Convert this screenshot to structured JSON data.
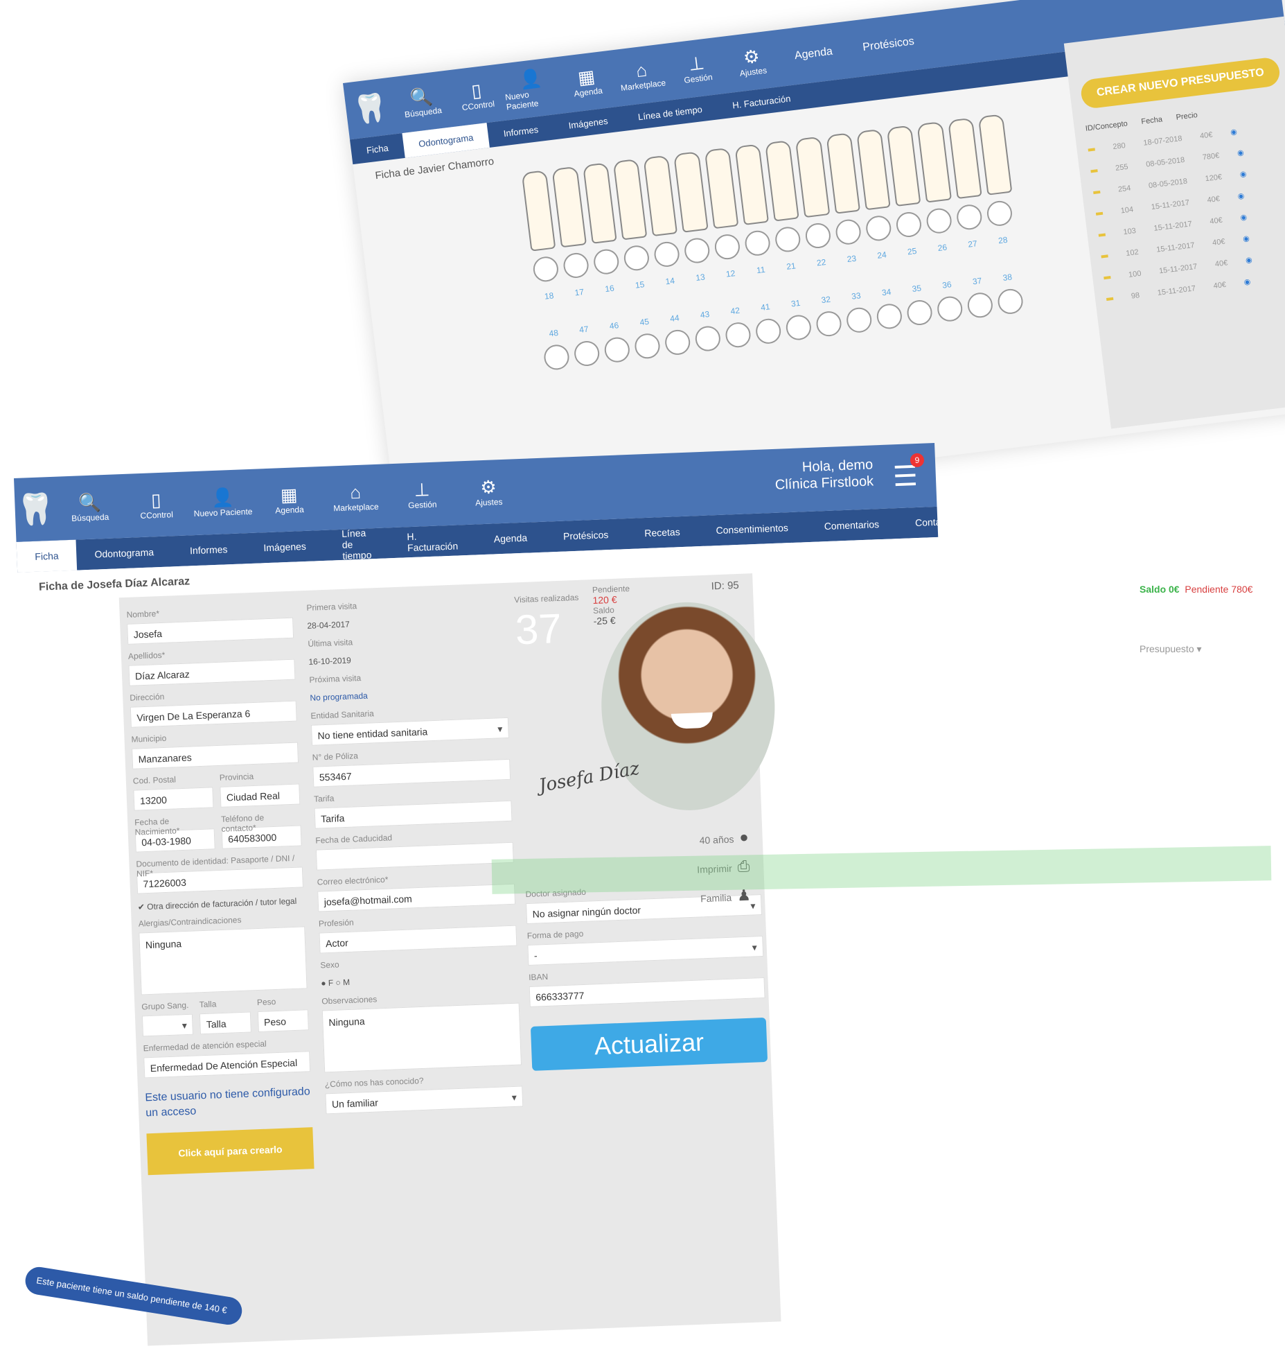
{
  "back_app": {
    "nav": [
      {
        "label": "Búsqueda",
        "icon": "search-icon",
        "glyph": "🔍"
      },
      {
        "label": "CControl",
        "icon": "clipboard-icon",
        "glyph": "▯"
      },
      {
        "label": "Nuevo Paciente",
        "icon": "add-user-icon",
        "glyph": "👤"
      },
      {
        "label": "Agenda",
        "icon": "calendar-icon",
        "glyph": "▦"
      },
      {
        "label": "Marketplace",
        "icon": "basket-icon",
        "glyph": "⌂"
      },
      {
        "label": "Gestión",
        "icon": "org-chart-icon",
        "glyph": "⊥"
      },
      {
        "label": "Ajustes",
        "icon": "gears-icon",
        "glyph": "⚙"
      }
    ],
    "subnav": [
      "Agenda",
      "Protésicos"
    ],
    "tabs": [
      "Ficha",
      "Odontograma",
      "Informes",
      "Imágenes",
      "Línea de tiempo",
      "H. Facturación",
      "Agenda",
      "Protésicos"
    ],
    "title": "Ficha de Javier Chamorro",
    "upper_numbers": [
      "18",
      "17",
      "16",
      "15",
      "14",
      "13",
      "12",
      "11",
      "21",
      "22",
      "23",
      "24",
      "25",
      "26",
      "27",
      "28"
    ],
    "lower_numbers": [
      "48",
      "47",
      "46",
      "45",
      "44",
      "43",
      "42",
      "41",
      "31",
      "32",
      "33",
      "34",
      "35",
      "36",
      "37",
      "38"
    ],
    "budget": {
      "button": "CREAR NUEVO PRESUPUESTO",
      "headers": [
        "ID/Concepto",
        "Fecha",
        "Precio"
      ],
      "rows": [
        {
          "id": "280",
          "date": "18-07-2018",
          "price": "40€"
        },
        {
          "id": "255",
          "date": "08-05-2018",
          "price": "780€"
        },
        {
          "id": "254",
          "date": "08-05-2018",
          "price": "120€"
        },
        {
          "id": "104",
          "date": "15-11-2017",
          "price": "40€"
        },
        {
          "id": "103",
          "date": "15-11-2017",
          "price": "40€"
        },
        {
          "id": "102",
          "date": "15-11-2017",
          "price": "40€"
        },
        {
          "id": "100",
          "date": "15-11-2017",
          "price": "40€"
        },
        {
          "id": "98",
          "date": "15-11-2017",
          "price": "40€"
        }
      ]
    }
  },
  "front_app": {
    "nav": [
      {
        "label": "Búsqueda",
        "icon": "search-icon",
        "glyph": "🔍"
      },
      {
        "label": "CControl",
        "icon": "clipboard-icon",
        "glyph": "▯"
      },
      {
        "label": "Nuevo Paciente",
        "icon": "add-user-icon",
        "glyph": "👤"
      },
      {
        "label": "Agenda",
        "icon": "calendar-icon",
        "glyph": "▦"
      },
      {
        "label": "Marketplace",
        "icon": "basket-icon",
        "glyph": "⌂"
      },
      {
        "label": "Gestión",
        "icon": "org-chart-icon",
        "glyph": "⊥"
      },
      {
        "label": "Ajustes",
        "icon": "gears-icon",
        "glyph": "⚙"
      }
    ],
    "greeting_line1": "Hola, demo",
    "greeting_line2": "Clínica Firstlook",
    "menu_badge": "9",
    "tabs": [
      "Ficha",
      "Odontograma",
      "Informes",
      "Imágenes",
      "Línea de tiempo",
      "H. Facturación",
      "Agenda",
      "Protésicos"
    ],
    "right_tabs": [
      "Recetas",
      "Consentimientos",
      "Comentarios",
      "Contactar"
    ],
    "title": "Ficha de Josefa Díaz Alcaraz",
    "id_label": "ID: 95",
    "form": {
      "nombre_label": "Nombre*",
      "nombre": "Josefa",
      "apellidos_label": "Apellidos*",
      "apellidos": "Díaz Alcaraz",
      "direccion_label": "Dirección",
      "direccion": "Virgen De La Esperanza 6",
      "municipio_label": "Municipio",
      "municipio": "Manzanares",
      "cp_label": "Cod. Postal",
      "cp": "13200",
      "provincia_label": "Provincia",
      "provincia": "Ciudad Real",
      "nacimiento_label": "Fecha de Nacimiento*",
      "nacimiento": "04-03-1980",
      "telefono_label": "Teléfono de contacto*",
      "telefono": "640583000",
      "documento_label": "Documento de identidad: Pasaporte / DNI / NIF*",
      "documento": "71226003",
      "otra_direccion": "Otra dirección de facturación / tutor legal",
      "alergias_label": "Alergias/Contraindicaciones",
      "alergias": "Ninguna",
      "grupo_label": "Grupo Sang.",
      "talla_label": "Talla",
      "talla_ph": "Talla",
      "peso_label": "Peso",
      "peso_ph": "Peso",
      "enfermedad_label": "Enfermedad de atención especial",
      "enfermedad_ph": "Enfermedad De Atención Especial",
      "sin_acceso": "Este usuario no tiene configurado un acceso",
      "crear_acceso": "Click aquí para crearlo",
      "primera_label": "Primera visita",
      "primera": "28-04-2017",
      "ultima_label": "Última visita",
      "ultima": "16-10-2019",
      "proxima_label": "Próxima visita",
      "proxima": "No programada",
      "entidad_label": "Entidad Sanitaria",
      "entidad": "No tiene entidad sanitaria",
      "poliza_label": "N° de Póliza",
      "poliza": "553467",
      "tarifa_label": "Tarifa",
      "tarifa": "Tarifa",
      "caducidad_label": "Fecha de Caducidad",
      "correo_label": "Correo electrónico*",
      "correo": "josefa@hotmail.com",
      "profesion_label": "Profesión",
      "profesion": "Actor",
      "sexo_label": "Sexo",
      "sexo": "● F ○ M",
      "observaciones_label": "Observaciones",
      "observaciones": "Ninguna",
      "conocido_label": "¿Cómo nos has conocido?",
      "conocido": "Un familiar",
      "visitas_label": "Visitas realizadas",
      "visitas": "37",
      "pendiente_label": "Pendiente",
      "pendiente": "120 €",
      "saldo_label": "Saldo",
      "saldo": "-25 €",
      "doctor_label": "Doctor asignado",
      "doctor": "No asignar ningún doctor",
      "pago_label": "Forma de pago",
      "pago": "-",
      "iban_label": "IBAN",
      "iban": "666333777",
      "actualizar": "Actualizar",
      "edad": "40 años",
      "imprimir": "Imprimir",
      "familia": "Familia",
      "firma": "Josefa Díaz"
    },
    "status_saldo": "Saldo 0€",
    "status_pendiente": "Pendiente 780€",
    "status_presupuesto": "Presupuesto",
    "notice": "Este paciente tiene un saldo pendiente de 140 €"
  },
  "colors": {
    "nav": "#4a74b4",
    "subnav": "#2d528d",
    "accent_yellow": "#e8c33c",
    "update_blue": "#3ea9e6",
    "pending_red": "#d84040"
  }
}
